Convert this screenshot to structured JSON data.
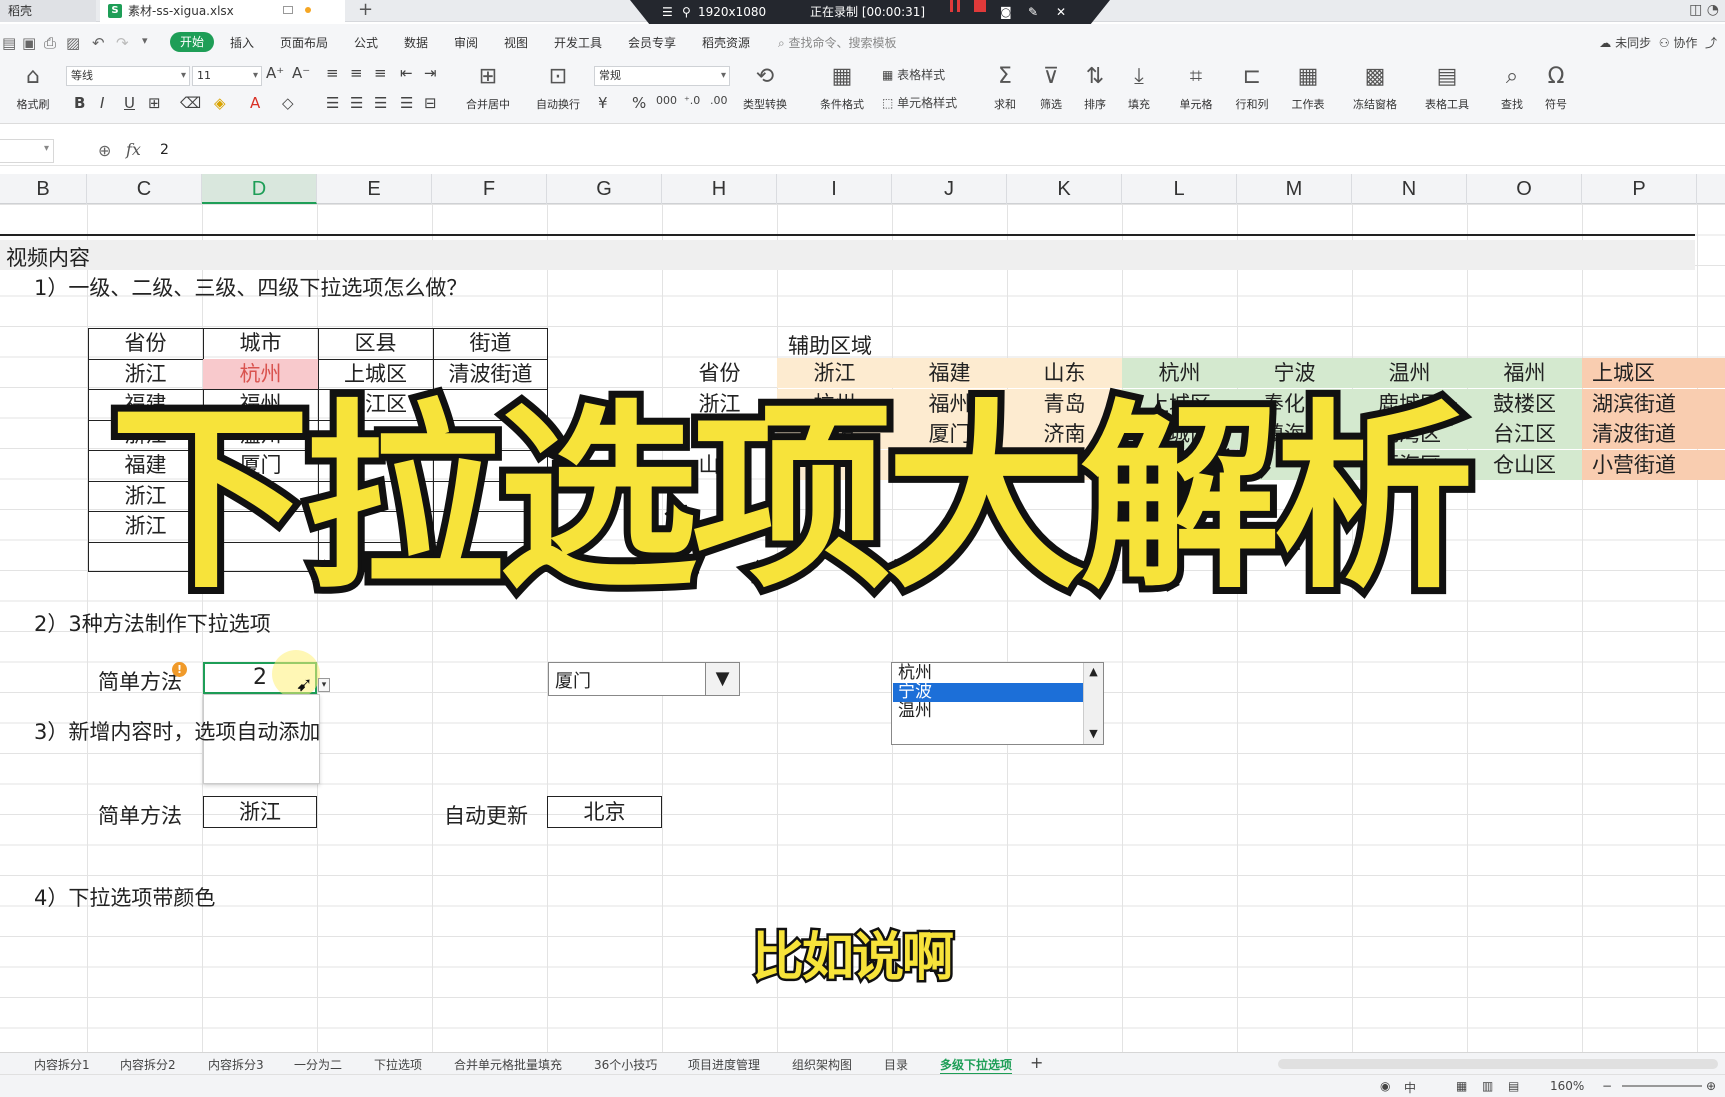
{
  "window": {
    "home_tab": "稻壳",
    "file_tab": "素材-ss-xigua.xlsx",
    "recorder_resolution": "1920x1080",
    "recorder_status": "正在录制 [00:00:31]"
  },
  "menu": {
    "items": [
      "开始",
      "插入",
      "页面布局",
      "公式",
      "数据",
      "审阅",
      "视图",
      "开发工具",
      "会员专享",
      "稻壳资源"
    ],
    "search_placeholder": "查找命令、搜索模板",
    "sync": "未同步",
    "collab": "协作"
  },
  "ribbon": {
    "format_painter": "格式刷",
    "font_name": "等线",
    "font_size": "11",
    "merge_center": "合并居中",
    "wrap_text": "自动换行",
    "number_format": "常规",
    "type_convert": "类型转换",
    "conditional_format": "条件格式",
    "table_style": "表格样式",
    "cell_style": "单元格样式",
    "sum": "求和",
    "filter": "筛选",
    "sort": "排序",
    "fill": "填充",
    "cell": "单元格",
    "rows_cols": "行和列",
    "worksheet": "工作表",
    "freeze": "冻结窗格",
    "table_tools": "表格工具",
    "find": "查找",
    "symbol": "符号"
  },
  "formula_bar": {
    "fx": "fx",
    "value": "2"
  },
  "columns": [
    "B",
    "C",
    "D",
    "E",
    "F",
    "G",
    "H",
    "I",
    "J",
    "K",
    "L",
    "M",
    "N",
    "O",
    "P"
  ],
  "active_column": "D",
  "sheet": {
    "section_title": "视频内容",
    "q1": "1）一级、二级、三级、四级下拉选项怎么做？",
    "q2": "2）3种方法制作下拉选项",
    "q3": "3）新增内容时，选项自动添加",
    "q4": "4）下拉选项带颜色",
    "main_table": {
      "headers": [
        "省份",
        "城市",
        "区县",
        "街道"
      ],
      "rows": [
        [
          "浙江",
          "杭州",
          "上城区",
          "清波街道"
        ],
        [
          "福建",
          "福州",
          "台江区",
          ""
        ],
        [
          "浙江",
          "温州",
          "",
          ""
        ],
        [
          "福建",
          "厦门",
          "",
          ""
        ],
        [
          "浙江",
          "",
          "",
          ""
        ],
        [
          "浙江",
          "",
          "",
          ""
        ]
      ]
    },
    "aux": {
      "title": "辅助区域",
      "row_labels": [
        "省份",
        "浙江",
        "福建",
        "山东"
      ],
      "provinces": [
        [
          "浙江",
          "福建",
          "山东"
        ],
        [
          "杭州",
          "福州",
          "青岛"
        ],
        [
          "宁波",
          "厦门",
          "济南"
        ],
        [
          "温州",
          "漳州",
          ""
        ]
      ],
      "cities": [
        [
          "杭州",
          "宁波",
          "温州",
          "福州"
        ],
        [
          "上城区",
          "奉化区",
          "鹿城区",
          "鼓楼区"
        ],
        [
          "下城区",
          "镇海区",
          "龙湾区",
          "台江区"
        ],
        [
          "江干区",
          "",
          "瓯海区",
          "仓山区"
        ]
      ],
      "districts": [
        "上城区",
        "湖滨街道",
        "清波街道",
        "小营街道"
      ],
      "colors": {
        "province_bg": "#fdebd0",
        "city_bg": "#d4e9cf",
        "district_bg": "#f9cdb0"
      }
    },
    "simple_method_label": "简单方法",
    "simple_method_value": "2",
    "combo_value": "厦门",
    "listbox_items": [
      "杭州",
      "宁波",
      "温州"
    ],
    "listbox_selected": 1,
    "q3_simple_label": "简单方法",
    "q3_simple_value": "浙江",
    "q3_auto_label": "自动更新",
    "q3_auto_value": "北京"
  },
  "overlay": {
    "big_title": "下拉选项大解析",
    "subtitle": "比如说啊"
  },
  "sheet_tabs": [
    "内容拆分1",
    "内容拆分2",
    "内容拆分3",
    "一分为二",
    "下拉选项",
    "合并单元格批量填充",
    "36个小技巧",
    "项目进度管理",
    "组织架构图",
    "目录",
    "多级下拉选项"
  ],
  "active_sheet_tab": "多级下拉选项",
  "status": {
    "zoom": "160%",
    "ime": "中"
  }
}
